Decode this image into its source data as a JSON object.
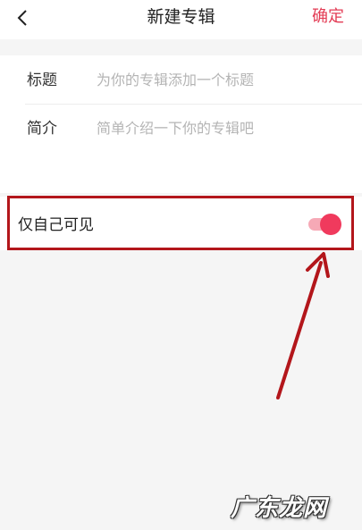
{
  "header": {
    "back_icon": "chevron-left-icon",
    "title": "新建专辑",
    "confirm_label": "确定"
  },
  "form": {
    "title_label": "标题",
    "title_placeholder": "为你的专辑添加一个标题",
    "title_value": "",
    "intro_label": "简介",
    "intro_placeholder": "简单介绍一下你的专辑吧",
    "intro_value": ""
  },
  "privacy": {
    "label": "仅自己可见",
    "enabled": true
  },
  "annotation": {
    "arrow_icon": "arrow-up-right-icon"
  },
  "watermark": {
    "text": "广东龙网"
  },
  "colors": {
    "accent": "#e33c55",
    "toggle_knob": "#f03a5d",
    "toggle_track": "#f6a9b6",
    "annotation": "#b3161b",
    "background_gray": "#f5f5f5"
  }
}
